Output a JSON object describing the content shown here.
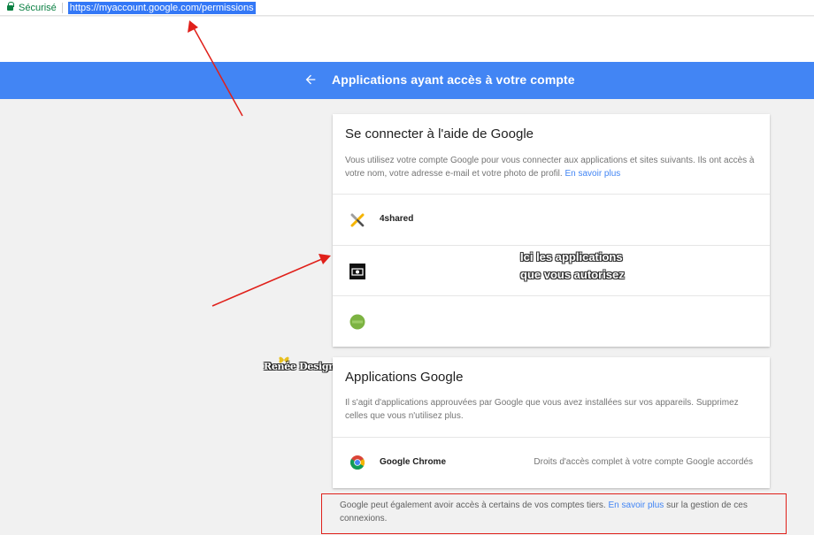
{
  "browser": {
    "secure_label": "Sécurisé",
    "url": "https://myaccount.google.com/permissions"
  },
  "header": {
    "title": "Applications ayant accès à votre compte",
    "back_icon": "arrow-back-icon"
  },
  "sign_in_card": {
    "title": "Se connecter à l'aide de Google",
    "description": "Vous utilisez votre compte Google pour vous connecter aux applications et sites suivants. Ils ont accès à votre nom, votre adresse e-mail et votre photo de profil.",
    "learn_more": "En savoir plus",
    "apps": [
      {
        "name": "4shared",
        "icon": "4shared-icon"
      },
      {
        "name": "",
        "icon": "black-app-icon"
      },
      {
        "name": "",
        "icon": "green-app-icon"
      }
    ]
  },
  "annotation": {
    "line1": "Ici les applications",
    "line2": "que vous autorisez"
  },
  "watermark": "Renée Design",
  "google_apps_card": {
    "title": "Applications Google",
    "description": "Il s'agit d'applications approuvées par Google que vous avez installées sur vos appareils. Supprimez celles que vous n'utilisez plus.",
    "apps": [
      {
        "name": "Google Chrome",
        "access": "Droits d'accès complet à votre compte Google accordés",
        "icon": "chrome-icon"
      }
    ]
  },
  "footer": {
    "text_before": "Google peut également avoir accès à certains de vos comptes tiers.",
    "learn_more": "En savoir plus",
    "text_after": "sur la gestion de ces connexions."
  },
  "colors": {
    "header_blue": "#4285f4",
    "link_blue": "#4285f4",
    "annotation_red": "#e0201a",
    "secure_green": "#0b8043"
  }
}
